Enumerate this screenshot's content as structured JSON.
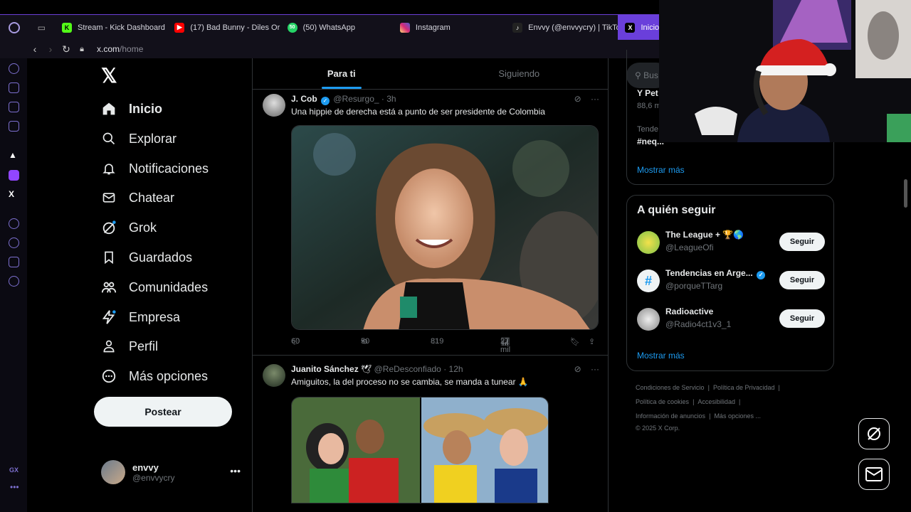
{
  "browser": {
    "tabs": [
      {
        "label": "Stream - Kick Dashboard",
        "favicon_color": "#53fc18",
        "favicon": "K"
      },
      {
        "label": "(17) Bad Bunny - Diles Or",
        "favicon_color": "#ff0000",
        "favicon": "▶"
      },
      {
        "label": "(50) WhatsApp",
        "favicon_color": "#25d366",
        "favicon": "50"
      },
      {
        "label": "Instagram",
        "favicon_color": "#d62976",
        "favicon": "◎"
      },
      {
        "label": "Envvy (@envvycry) | TikTo",
        "favicon_color": "#222222",
        "favicon": "♪"
      },
      {
        "label": "Inicio",
        "favicon_color": "#000000",
        "favicon": "X",
        "active": true
      }
    ],
    "url_host": "x.com",
    "url_path": "/home"
  },
  "nav": {
    "items": [
      {
        "label": "Inicio",
        "icon": "home-icon",
        "glyph": "⌂",
        "active": true
      },
      {
        "label": "Explorar",
        "icon": "search-icon",
        "glyph": "⚲"
      },
      {
        "label": "Notificaciones",
        "icon": "bell-icon",
        "glyph": "🔔︎"
      },
      {
        "label": "Chatear",
        "icon": "mail-icon",
        "glyph": "✉"
      },
      {
        "label": "Grok",
        "icon": "grok-icon",
        "glyph": "⊘"
      },
      {
        "label": "Guardados",
        "icon": "bookmark-icon",
        "glyph": "🔖︎"
      },
      {
        "label": "Comunidades",
        "icon": "communities-icon",
        "glyph": "👥︎"
      },
      {
        "label": "Empresa",
        "icon": "lightning-icon",
        "glyph": "ϟ"
      },
      {
        "label": "Perfil",
        "icon": "person-icon",
        "glyph": "👤︎"
      },
      {
        "label": "Más opciones",
        "icon": "more-circle-icon",
        "glyph": "⋯"
      }
    ],
    "post_label": "Postear",
    "account": {
      "name": "envvy",
      "handle": "@envvycry"
    }
  },
  "feed": {
    "tabs": [
      {
        "label": "Para ti",
        "active": true
      },
      {
        "label": "Siguiendo"
      }
    ],
    "tweets": [
      {
        "name": "J. Cob",
        "handle": "@Resurgo_",
        "time": "· 3h",
        "text": "Una hippie de derecha está a punto de ser presidente de Colombia",
        "replies": "60",
        "retweets": "50",
        "likes": "819",
        "views": "27 mil"
      },
      {
        "name": "Juanito Sánchez",
        "handle": "@ReDesconfiado",
        "time": "· 12h",
        "text": "Amiguitos, la del proceso no  se cambia, se manda a tunear 🙏"
      }
    ]
  },
  "right": {
    "search_placeholder": "Bus",
    "trends": {
      "item1": "Y Pet",
      "item1_count": "88,6 m",
      "item2_label": "Tende",
      "item2": "#neq...",
      "show_more": "Mostrar más"
    },
    "who_to_follow": {
      "title": "A quién seguir",
      "accounts": [
        {
          "name": "The League + 🏆🌎",
          "handle": "@LeagueOfi",
          "button": "Seguir"
        },
        {
          "name": "Tendencias en Arge...",
          "handle": "@porqueTTarg",
          "button": "Seguir",
          "verified": true
        },
        {
          "name": "Radioactive",
          "handle": "@Radio4ct1v3_1",
          "button": "Seguir"
        }
      ],
      "show_more": "Mostrar más"
    },
    "footer": {
      "line1": [
        "Condiciones de Servicio",
        "|",
        "Política de Privacidad",
        "|"
      ],
      "line2": [
        "Política de cookies",
        "|",
        "Accesibilidad",
        "|"
      ],
      "line3": [
        "Información de anuncios",
        "|",
        "Más opciones ..."
      ],
      "copyright": "© 2025 X Corp."
    }
  },
  "colors": {
    "accent": "#1d9bf0",
    "opera": "#6a3fdb"
  }
}
